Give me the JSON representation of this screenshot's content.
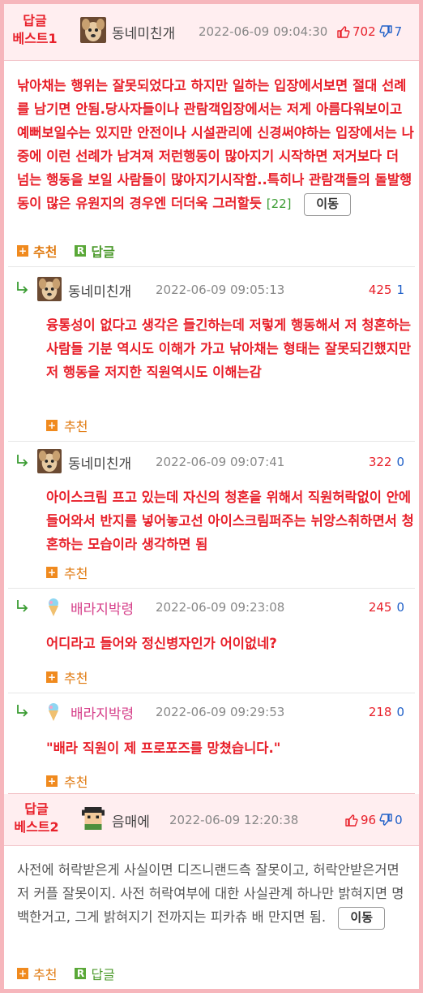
{
  "best1": {
    "label_line1": "답글",
    "label_line2": "베스트1",
    "nickname": "동네미친개",
    "date": "2022-06-09 09:04:30",
    "up": "702",
    "down": "7",
    "body": "낚아채는 행위는 잘못되었다고 하지만 일하는 입장에서보면 절대 선례를 남기면 안됨.당사자들이나 관람객입장에서는 저게 아름다워보이고 예뻐보일수는 있지만 안전이나 시설관리에 신경써야하는 입장에서는 나중에 이런 선례가 남겨져 저런행동이 많아지기 시작하면 저거보다 더 넘는 행동을 보일 사람들이 많아지기시작함..특히나 관람객들의 돌발행동이 많은 유원지의 경우엔 더더욱 그러할듯",
    "reply_count": "[22]",
    "move_label": "이동",
    "recommend_label": "추천",
    "reply_label": "답글"
  },
  "replies": [
    {
      "nickname": "동네미친개",
      "date": "2022-06-09 09:05:13",
      "up": "425",
      "down": "1",
      "text": "융통성이 없다고 생각은 들긴하는데 저렇게 행동해서 저 청혼하는 사람들 기분 역시도 이해가 가고 낚아채는 형태는 잘못되긴했지만 저 행동을 저지한 직원역시도 이해는감",
      "recommend_label": "추천"
    },
    {
      "nickname": "동네미친개",
      "date": "2022-06-09 09:07:41",
      "up": "322",
      "down": "0",
      "text": "아이스크림 프고 있는데 자신의 청혼을 위해서 직원허락없이 안에들어와서 반지를 넣어놓고선 아이스크림퍼주는 뉘앙스취하면서 청혼하는 모습이라 생각하면 됨",
      "recommend_label": "추천"
    },
    {
      "nickname": "배라지박령",
      "date": "2022-06-09 09:23:08",
      "up": "245",
      "down": "0",
      "text": "어디라고 들어와 정신병자인가 어이없네?",
      "recommend_label": "추천"
    },
    {
      "nickname": "배라지박령",
      "date": "2022-06-09 09:29:53",
      "up": "218",
      "down": "0",
      "text": "\"배라 직원이 제 프로포즈를 망쳤습니다.\"",
      "recommend_label": "추천"
    }
  ],
  "best2": {
    "label_line1": "답글",
    "label_line2": "베스트2",
    "nickname": "음매에",
    "date": "2022-06-09 12:20:38",
    "up": "96",
    "down": "0",
    "body": "사전에 허락받은게 사실이면 디즈니랜드측 잘못이고, 허락안받은거면 저 커플 잘못이지. 사전 허락여부에 대한 사실관계 하나만 밝혀지면 명백한거고, 그게 밝혀지기 전까지는 피카츄 배 만지면 됨.",
    "move_label": "이동",
    "recommend_label": "추천",
    "reply_label": "답글"
  },
  "colors": {
    "accent_red": "#e8202a",
    "border_pink": "#f6b6bc",
    "header_bg": "#ffeef0",
    "recommend_orange": "#f08a1e",
    "reply_green": "#5aa838",
    "down_blue": "#2060c8"
  }
}
